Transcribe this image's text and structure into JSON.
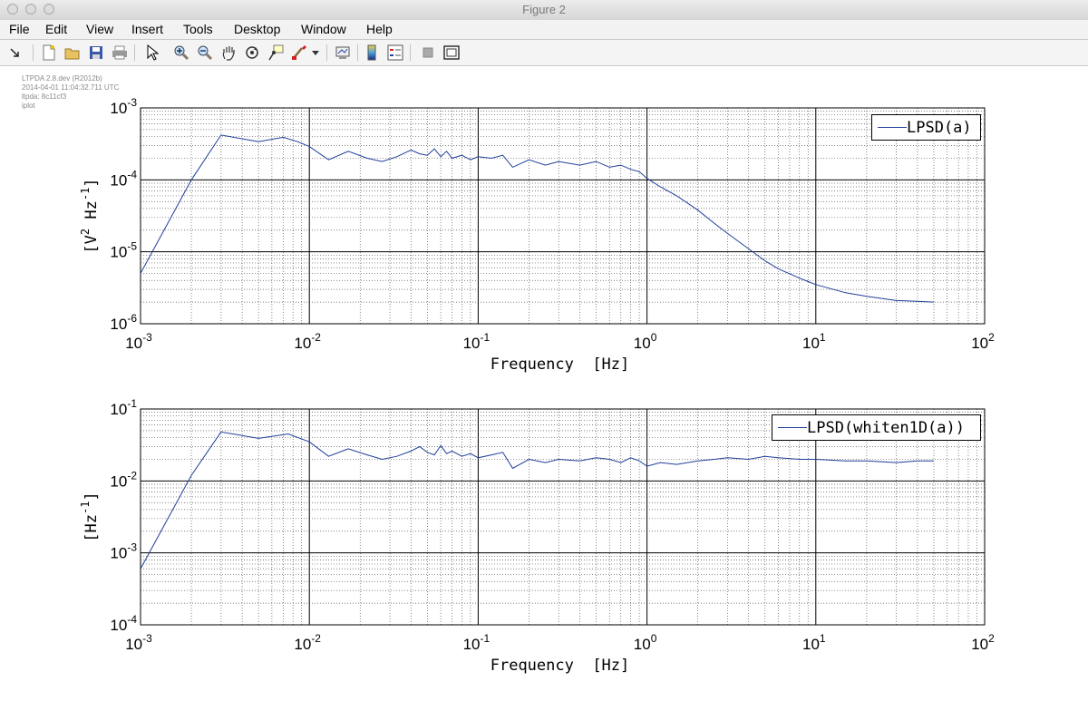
{
  "window": {
    "title": "Figure 2"
  },
  "menu": {
    "items": [
      "File",
      "Edit",
      "View",
      "Insert",
      "Tools",
      "Desktop",
      "Window",
      "Help"
    ]
  },
  "toolbar": {
    "icons": [
      "pointer-arrow-icon",
      "new-figure-icon",
      "open-file-icon",
      "save-icon",
      "print-icon",
      "select-arrow-icon",
      "zoom-in-icon",
      "zoom-out-icon",
      "pan-hand-icon",
      "rotate-3d-icon",
      "data-cursor-icon",
      "brush-icon",
      "brush-dropdown-icon",
      "link-plot-icon",
      "colorbar-icon",
      "legend-icon",
      "hide-plot-tools-icon",
      "show-plot-tools-icon"
    ]
  },
  "info": {
    "lines": [
      "LTPDA 2.8.dev (R2012b)",
      "2014-04-01 11:04:32.711 UTC",
      "ltpda: 8c11cf3",
      "iplot"
    ]
  },
  "colors": {
    "series": "#1f3f99",
    "axes": "#000000"
  },
  "chart_data": [
    {
      "type": "line",
      "xscale": "log",
      "yscale": "log",
      "xlim": [
        0.001,
        100
      ],
      "ylim": [
        1e-06,
        0.001
      ],
      "xlabel": "Frequency  [Hz]",
      "ylabel": {
        "text": "[V",
        "sup1": "2",
        "mid": " Hz",
        "sup2": "-1",
        "end": "]"
      },
      "xticks": [
        {
          "base": "10",
          "exp": "-3"
        },
        {
          "base": "10",
          "exp": "-2"
        },
        {
          "base": "10",
          "exp": "-1"
        },
        {
          "base": "10",
          "exp": "0"
        },
        {
          "base": "10",
          "exp": "1"
        },
        {
          "base": "10",
          "exp": "2"
        }
      ],
      "yticks": [
        {
          "base": "10",
          "exp": "-6"
        },
        {
          "base": "10",
          "exp": "-5"
        },
        {
          "base": "10",
          "exp": "-4"
        },
        {
          "base": "10",
          "exp": "-3"
        }
      ],
      "grid": true,
      "legend": "top-right",
      "series": [
        {
          "name": "LPSD(a)",
          "x": [
            0.001,
            0.002,
            0.003,
            0.005,
            0.007,
            0.0085,
            0.01,
            0.013,
            0.017,
            0.022,
            0.027,
            0.033,
            0.04,
            0.045,
            0.05,
            0.055,
            0.06,
            0.065,
            0.07,
            0.08,
            0.09,
            0.1,
            0.12,
            0.14,
            0.16,
            0.2,
            0.25,
            0.3,
            0.4,
            0.5,
            0.6,
            0.7,
            0.8,
            0.9,
            1.0,
            1.2,
            1.5,
            2.0,
            2.5,
            3.0,
            4.0,
            5.0,
            6.0,
            8.0,
            10,
            15,
            20,
            30,
            40,
            50
          ],
          "y": [
            5e-06,
            0.0001,
            0.00042,
            0.00034,
            0.00039,
            0.00034,
            0.00029,
            0.00019,
            0.00025,
            0.0002,
            0.00018,
            0.00021,
            0.00026,
            0.00023,
            0.00022,
            0.00027,
            0.00021,
            0.00025,
            0.0002,
            0.00022,
            0.00019,
            0.00021,
            0.0002,
            0.00022,
            0.00015,
            0.00019,
            0.00016,
            0.00018,
            0.00016,
            0.00018,
            0.00015,
            0.00016,
            0.00014,
            0.00013,
            0.000105,
            8e-05,
            6e-05,
            3.8e-05,
            2.5e-05,
            1.8e-05,
            1.1e-05,
            7.5e-06,
            5.8e-06,
            4.3e-06,
            3.5e-06,
            2.7e-06,
            2.4e-06,
            2.1e-06,
            2.05e-06,
            2e-06
          ]
        }
      ]
    },
    {
      "type": "line",
      "xscale": "log",
      "yscale": "log",
      "xlim": [
        0.001,
        100
      ],
      "ylim": [
        0.0001,
        0.1
      ],
      "xlabel": "Frequency  [Hz]",
      "ylabel": {
        "text": "[Hz",
        "sup1": "-1",
        "end": "]"
      },
      "xticks": [
        {
          "base": "10",
          "exp": "-3"
        },
        {
          "base": "10",
          "exp": "-2"
        },
        {
          "base": "10",
          "exp": "-1"
        },
        {
          "base": "10",
          "exp": "0"
        },
        {
          "base": "10",
          "exp": "1"
        },
        {
          "base": "10",
          "exp": "2"
        }
      ],
      "yticks": [
        {
          "base": "10",
          "exp": "-4"
        },
        {
          "base": "10",
          "exp": "-3"
        },
        {
          "base": "10",
          "exp": "-2"
        },
        {
          "base": "10",
          "exp": "-1"
        }
      ],
      "grid": true,
      "legend": "top-right",
      "series": [
        {
          "name": "LPSD(whiten1D(a))",
          "x": [
            0.001,
            0.002,
            0.003,
            0.005,
            0.0075,
            0.01,
            0.013,
            0.017,
            0.022,
            0.027,
            0.033,
            0.04,
            0.045,
            0.05,
            0.055,
            0.06,
            0.065,
            0.07,
            0.08,
            0.09,
            0.1,
            0.12,
            0.14,
            0.16,
            0.2,
            0.25,
            0.3,
            0.4,
            0.5,
            0.6,
            0.7,
            0.8,
            0.9,
            1.0,
            1.2,
            1.5,
            2.0,
            2.5,
            3.0,
            4.0,
            5.0,
            6.0,
            8.0,
            10,
            15,
            20,
            30,
            40,
            50
          ],
          "y": [
            0.0006,
            0.012,
            0.048,
            0.039,
            0.045,
            0.035,
            0.022,
            0.028,
            0.023,
            0.02,
            0.022,
            0.026,
            0.03,
            0.025,
            0.023,
            0.031,
            0.024,
            0.026,
            0.022,
            0.024,
            0.021,
            0.023,
            0.025,
            0.015,
            0.02,
            0.018,
            0.02,
            0.019,
            0.021,
            0.02,
            0.018,
            0.021,
            0.019,
            0.016,
            0.018,
            0.017,
            0.019,
            0.02,
            0.021,
            0.02,
            0.022,
            0.021,
            0.02,
            0.02,
            0.019,
            0.019,
            0.018,
            0.019,
            0.019
          ]
        }
      ]
    }
  ]
}
